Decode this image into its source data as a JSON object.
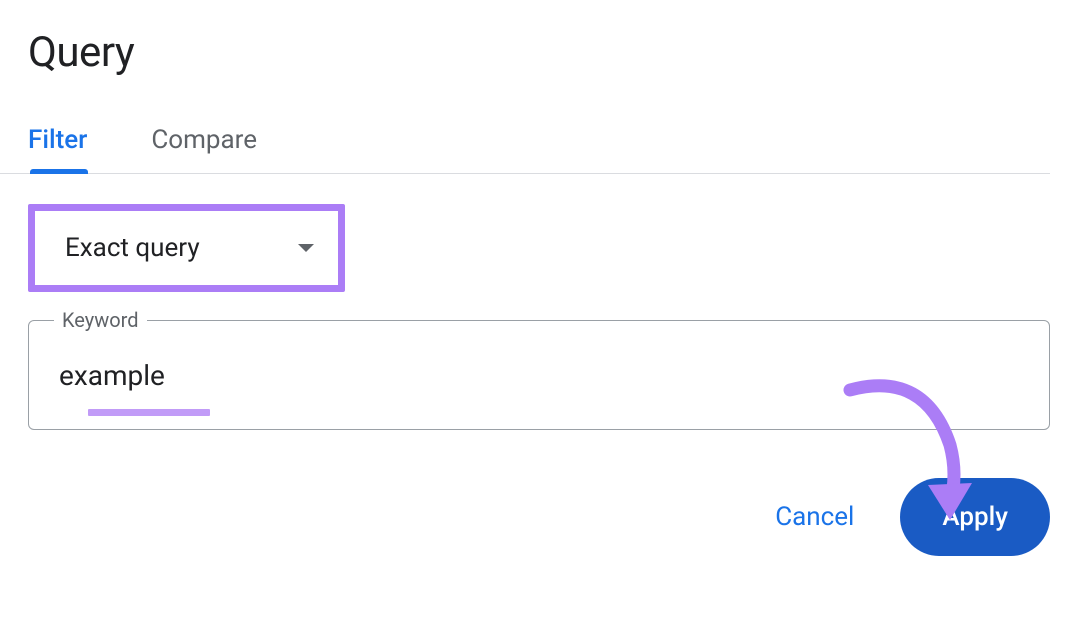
{
  "title": "Query",
  "tabs": {
    "filter": "Filter",
    "compare": "Compare",
    "active": "filter"
  },
  "dropdown": {
    "selected": "Exact query"
  },
  "keyword": {
    "label": "Keyword",
    "value": "example"
  },
  "actions": {
    "cancel": "Cancel",
    "apply": "Apply"
  },
  "annotations": {
    "dropdown_highlight_color": "#ab7df6",
    "underline_color": "#c19bf7",
    "arrow_color": "#ab7df6"
  }
}
